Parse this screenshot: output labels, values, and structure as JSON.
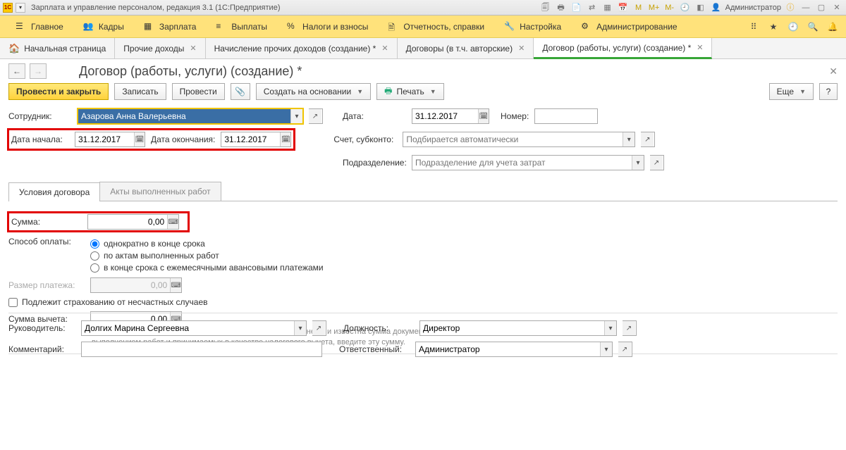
{
  "titlebar": {
    "title": "Зарплата и управление персоналом, редакция 3.1  (1С:Предприятие)",
    "user": "Администратор",
    "m_labels": [
      "М",
      "М+",
      "М-"
    ]
  },
  "mainmenu": [
    {
      "label": "Главное"
    },
    {
      "label": "Кадры"
    },
    {
      "label": "Зарплата"
    },
    {
      "label": "Выплаты"
    },
    {
      "label": "Налоги и взносы"
    },
    {
      "label": "Отчетность, справки"
    },
    {
      "label": "Настройка"
    },
    {
      "label": "Администрирование"
    }
  ],
  "tabs": [
    {
      "label": "Начальная страница",
      "home": true
    },
    {
      "label": "Прочие доходы",
      "close": true
    },
    {
      "label": "Начисление прочих доходов (создание) *",
      "close": true
    },
    {
      "label": "Договоры (в т.ч. авторские)",
      "close": true
    },
    {
      "label": "Договор (работы, услуги) (создание) *",
      "close": true,
      "active": true
    }
  ],
  "page_title": "Договор (работы, услуги) (создание) *",
  "toolbar": {
    "main": "Провести и закрыть",
    "write": "Записать",
    "post": "Провести",
    "create_on": "Создать на основании",
    "print": "Печать",
    "more": "Еще"
  },
  "fields": {
    "employee_lbl": "Сотрудник:",
    "employee": "Азарова Анна Валерьевна",
    "date_lbl": "Дата:",
    "date": "31.12.2017",
    "number_lbl": "Номер:",
    "number": "",
    "date_start_lbl": "Дата начала:",
    "date_start": "31.12.2017",
    "date_end_lbl": "Дата окончания:",
    "date_end": "31.12.2017",
    "account_lbl": "Счет, субконто:",
    "account_ph": "Подбирается автоматически",
    "dept_lbl": "Подразделение:",
    "dept_ph": "Подразделение для учета затрат"
  },
  "inner_tabs": {
    "t1": "Условия договора",
    "t2": "Акты выполненных работ"
  },
  "contract": {
    "sum_lbl": "Сумма:",
    "sum": "0,00",
    "pay_lbl": "Способ оплаты:",
    "pay_options": [
      "однократно в конце срока",
      "по актам выполненных работ",
      "в конце срока с ежемесячными авансовыми платежами"
    ],
    "pay_amount_lbl": "Размер платежа:",
    "pay_amount": "0,00",
    "insurance": "Подлежит страхованию от несчастных случаев",
    "deduction_lbl": "Сумма вычета:",
    "deduction": "0,00",
    "hint": "Если при вводе информации о договоре работы уже выполнены и известна сумма документально подтвержденных расходов, связанных с выполнением работ и принимаемых в качестве налогового вычета, введите эту сумму."
  },
  "footer": {
    "head_lbl": "Руководитель:",
    "head": "Долгих Марина Сергеевна",
    "position_lbl": "Должность:",
    "position": "Директор",
    "comment_lbl": "Комментарий:",
    "comment": "",
    "resp_lbl": "Ответственный:",
    "resp": "Администратор"
  }
}
